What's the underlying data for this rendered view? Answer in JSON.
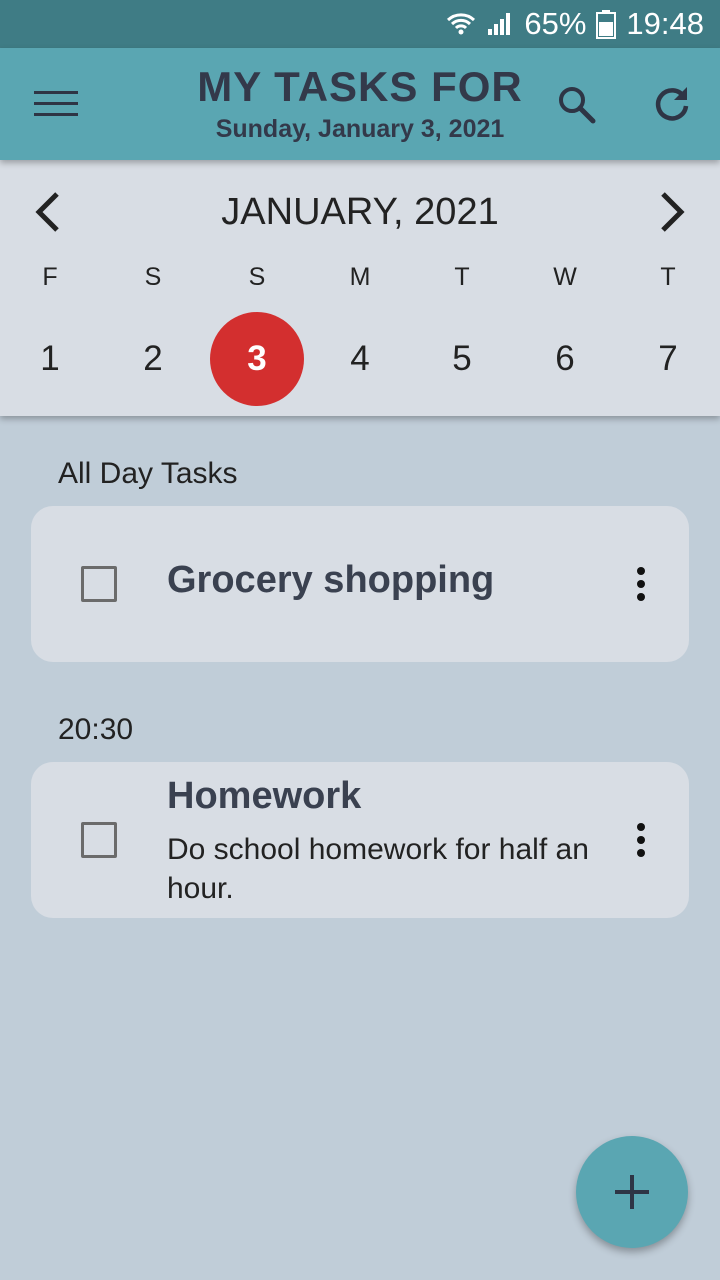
{
  "status_bar": {
    "battery_percent": "65%",
    "time": "19:48",
    "icons": [
      "wifi-icon",
      "signal-icon",
      "battery-icon"
    ]
  },
  "app_bar": {
    "title": "MY TASKS FOR",
    "subtitle": "Sunday, January 3, 2021",
    "icons": [
      "menu-icon",
      "search-icon",
      "refresh-icon"
    ]
  },
  "calendar": {
    "month_label": "JANUARY, 2021",
    "weekdays": [
      "F",
      "S",
      "S",
      "M",
      "T",
      "W",
      "T"
    ],
    "days": [
      "1",
      "2",
      "3",
      "4",
      "5",
      "6",
      "7"
    ],
    "selected_day": "3",
    "icons": [
      "chevron-left-icon",
      "chevron-right-icon"
    ]
  },
  "sections": [
    {
      "label": "All Day Tasks",
      "tasks": [
        {
          "title": "Grocery shopping",
          "description": "",
          "checked": false
        }
      ]
    },
    {
      "label": "20:30",
      "tasks": [
        {
          "title": "Homework",
          "description": "Do school homework for half an hour.",
          "checked": false
        }
      ]
    }
  ],
  "fab": {
    "icon": "plus-icon"
  },
  "colors": {
    "status_bar": "#3f7c85",
    "app_bar": "#5aa6b2",
    "background": "#c0cdd8",
    "card": "#d8dde4",
    "selected_day": "#d32f2f",
    "title_text": "#33394a"
  }
}
